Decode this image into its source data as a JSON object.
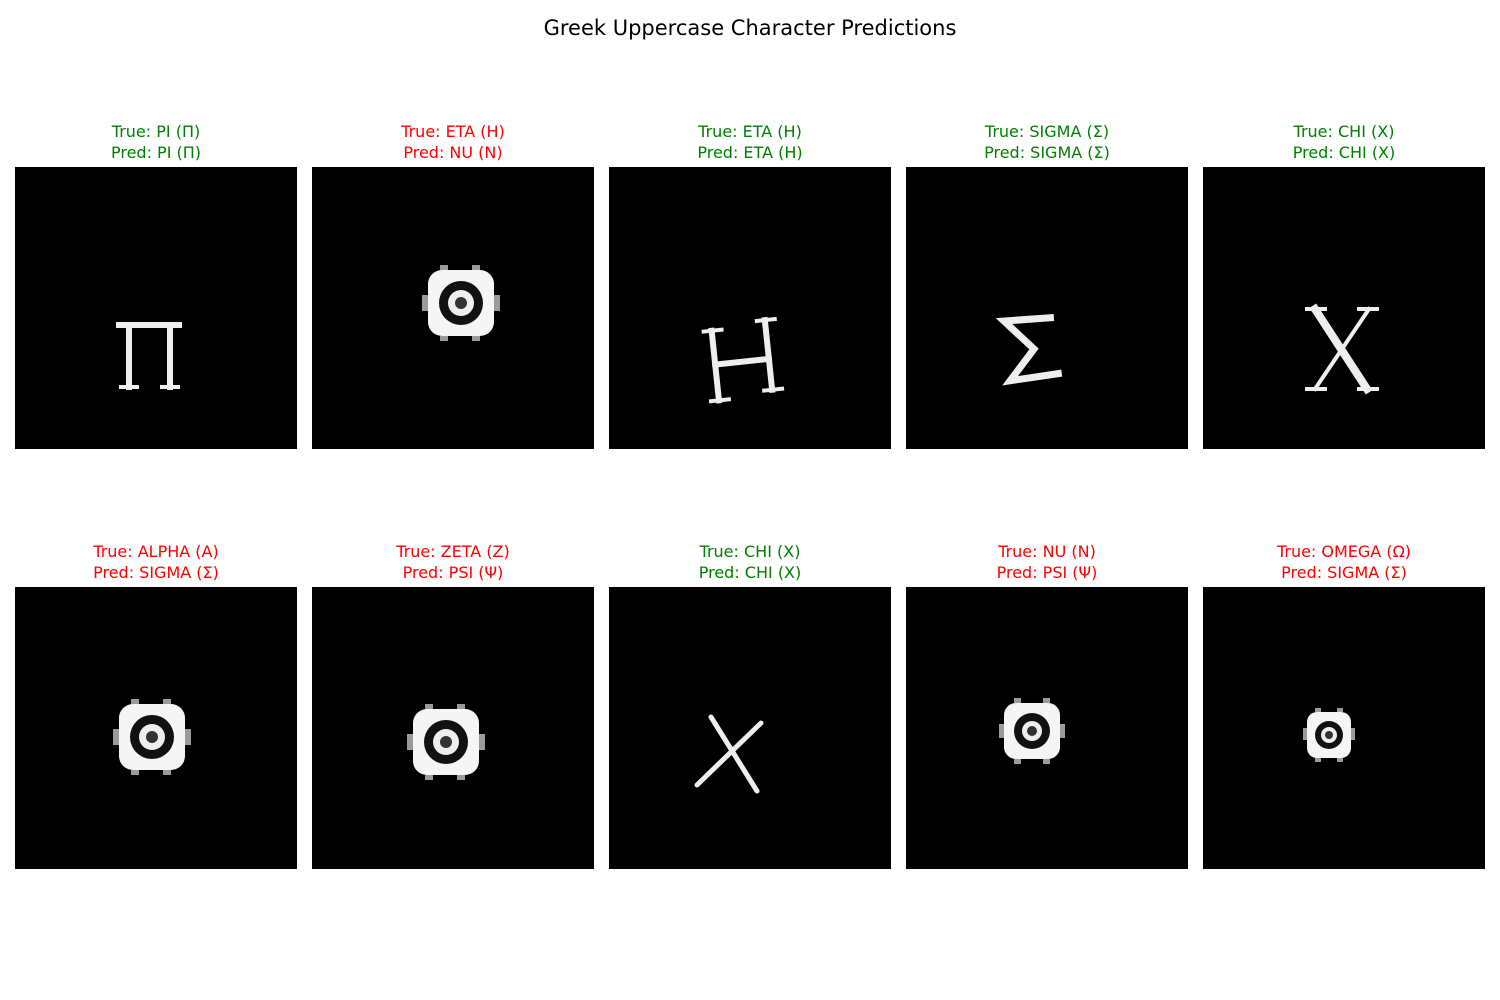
{
  "title": "Greek Uppercase Character Predictions",
  "colors": {
    "correct": "#008000",
    "wrong": "#ff0000",
    "image_background": "#000000",
    "glyph": "#f2f2f2"
  },
  "panels": [
    {
      "true_label": "True: PI (Π)",
      "pred_label": "Pred: PI (Π)",
      "correct": true,
      "glyph": "pi"
    },
    {
      "true_label": "True: ETA (H)",
      "pred_label": "Pred: NU (N)",
      "correct": false,
      "glyph": "ring-blob"
    },
    {
      "true_label": "True: ETA (H)",
      "pred_label": "Pred: ETA (H)",
      "correct": true,
      "glyph": "eta"
    },
    {
      "true_label": "True: SIGMA (Σ)",
      "pred_label": "Pred: SIGMA (Σ)",
      "correct": true,
      "glyph": "sigma"
    },
    {
      "true_label": "True: CHI (X)",
      "pred_label": "Pred: CHI (X)",
      "correct": true,
      "glyph": "chi"
    },
    {
      "true_label": "True: ALPHA (A)",
      "pred_label": "Pred: SIGMA (Σ)",
      "correct": false,
      "glyph": "ring-blob"
    },
    {
      "true_label": "True: ZETA (Z)",
      "pred_label": "Pred: PSI (Ψ)",
      "correct": false,
      "glyph": "ring-blob"
    },
    {
      "true_label": "True: CHI (X)",
      "pred_label": "Pred: CHI (X)",
      "correct": true,
      "glyph": "chi-thin"
    },
    {
      "true_label": "True: NU (N)",
      "pred_label": "Pred: PSI (Ψ)",
      "correct": false,
      "glyph": "ring-blob"
    },
    {
      "true_label": "True: OMEGA (Ω)",
      "pred_label": "Pred: SIGMA (Σ)",
      "correct": false,
      "glyph": "ring-blob"
    }
  ]
}
